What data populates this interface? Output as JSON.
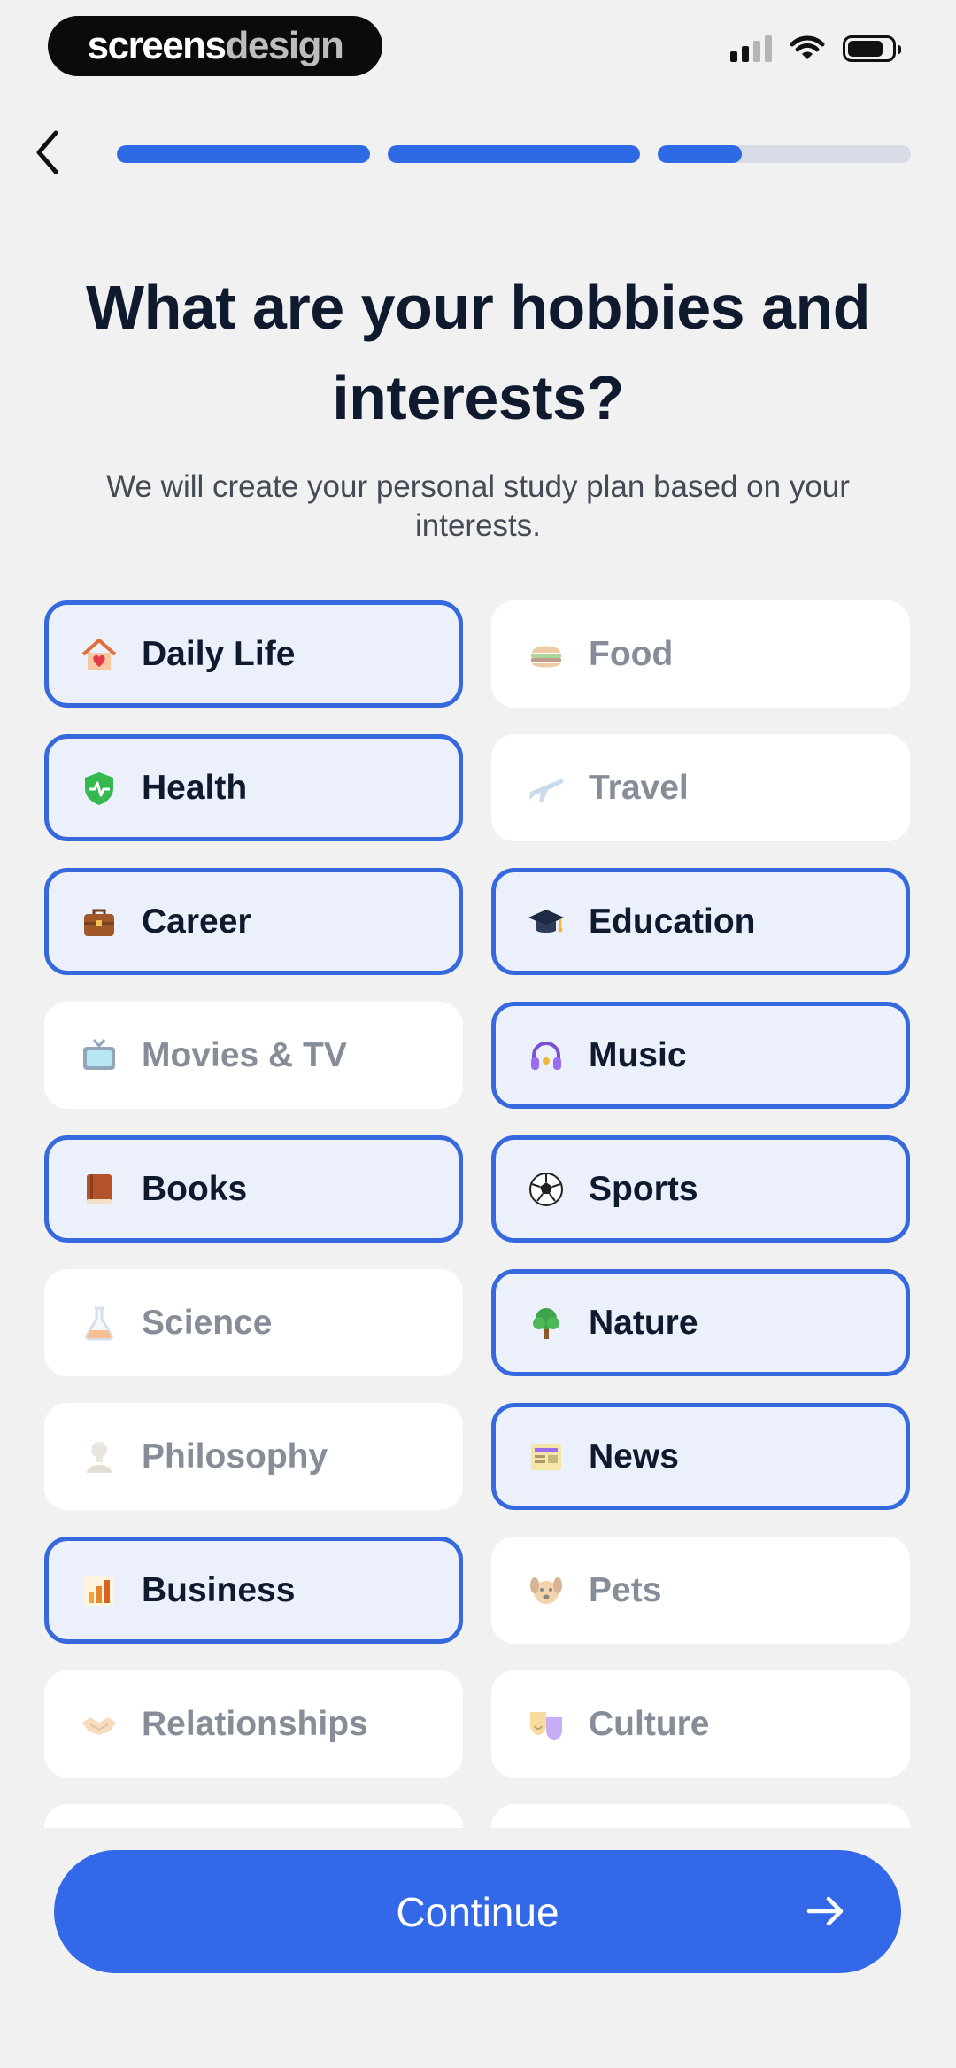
{
  "brand": {
    "part1": "screens",
    "part2": "design"
  },
  "header": {
    "back_icon": "chevron-left-icon",
    "progress": [
      1.0,
      1.0,
      0.33,
      0.0
    ]
  },
  "title": "What are your hobbies and interests?",
  "subtitle": "We will create your personal study plan based on your interests.",
  "colors": {
    "accent": "#3369e8",
    "selected_bg": "#ecf0fb",
    "selected_border": "#3669de",
    "chip_bg": "#ffffff",
    "page_bg": "#f1f1f1",
    "title": "#0f1a2e"
  },
  "interests": [
    {
      "label": "Daily Life",
      "icon": "house-heart-icon",
      "selected": true
    },
    {
      "label": "Food",
      "icon": "burger-icon",
      "selected": false
    },
    {
      "label": "Health",
      "icon": "shield-pulse-icon",
      "selected": true
    },
    {
      "label": "Travel",
      "icon": "airplane-icon",
      "selected": false
    },
    {
      "label": "Career",
      "icon": "briefcase-icon",
      "selected": true
    },
    {
      "label": "Education",
      "icon": "graduation-cap-icon",
      "selected": true
    },
    {
      "label": "Movies & TV",
      "icon": "tv-icon",
      "selected": false
    },
    {
      "label": "Music",
      "icon": "headphones-icon",
      "selected": true
    },
    {
      "label": "Books",
      "icon": "book-icon",
      "selected": true
    },
    {
      "label": "Sports",
      "icon": "soccer-ball-icon",
      "selected": true
    },
    {
      "label": "Science",
      "icon": "flask-icon",
      "selected": false
    },
    {
      "label": "Nature",
      "icon": "tree-icon",
      "selected": true
    },
    {
      "label": "Philosophy",
      "icon": "bust-statue-icon",
      "selected": false
    },
    {
      "label": "News",
      "icon": "newspaper-icon",
      "selected": true
    },
    {
      "label": "Business",
      "icon": "bar-chart-icon",
      "selected": true
    },
    {
      "label": "Pets",
      "icon": "dog-icon",
      "selected": false
    },
    {
      "label": "Relationships",
      "icon": "handshake-icon",
      "selected": false
    },
    {
      "label": "Culture",
      "icon": "theater-masks-icon",
      "selected": false
    },
    {
      "label": "",
      "icon": "",
      "selected": false
    },
    {
      "label": "",
      "icon": "",
      "selected": false
    }
  ],
  "continue": {
    "label": "Continue",
    "icon": "arrow-right-icon"
  }
}
